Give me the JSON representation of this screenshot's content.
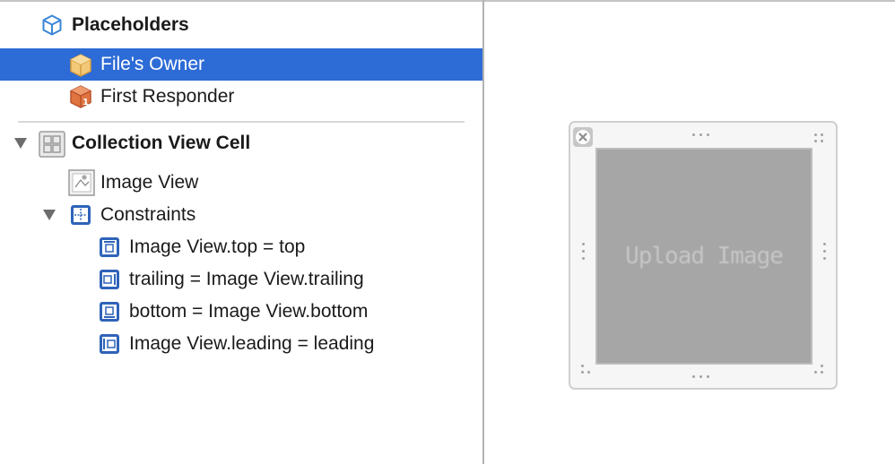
{
  "outline": {
    "placeholders": {
      "label": "Placeholders"
    },
    "files_owner": {
      "label": "File's Owner",
      "selected": true
    },
    "first_responder": {
      "label": "First Responder"
    },
    "collection_view_cell": {
      "label": "Collection View Cell",
      "expanded": true
    },
    "image_view": {
      "label": "Image View"
    },
    "constraints": {
      "label": "Constraints",
      "expanded": true,
      "items": [
        {
          "label": "Image View.top = top",
          "icon": "constraint-top-icon"
        },
        {
          "label": "trailing = Image View.trailing",
          "icon": "constraint-trailing-icon"
        },
        {
          "label": "bottom = Image View.bottom",
          "icon": "constraint-bottom-icon"
        },
        {
          "label": "Image View.leading = leading",
          "icon": "constraint-leading-icon"
        }
      ]
    }
  },
  "canvas": {
    "image_placeholder_text": "Upload Image"
  },
  "colors": {
    "selection": "#2d6bd6",
    "constraint_icon": "#2e63b9",
    "placeholder_icon": "#3a86d8",
    "files_owner_icon": "#f3c877",
    "first_responder_icon": "#e07440",
    "image_fill": "#a6a6a6"
  }
}
